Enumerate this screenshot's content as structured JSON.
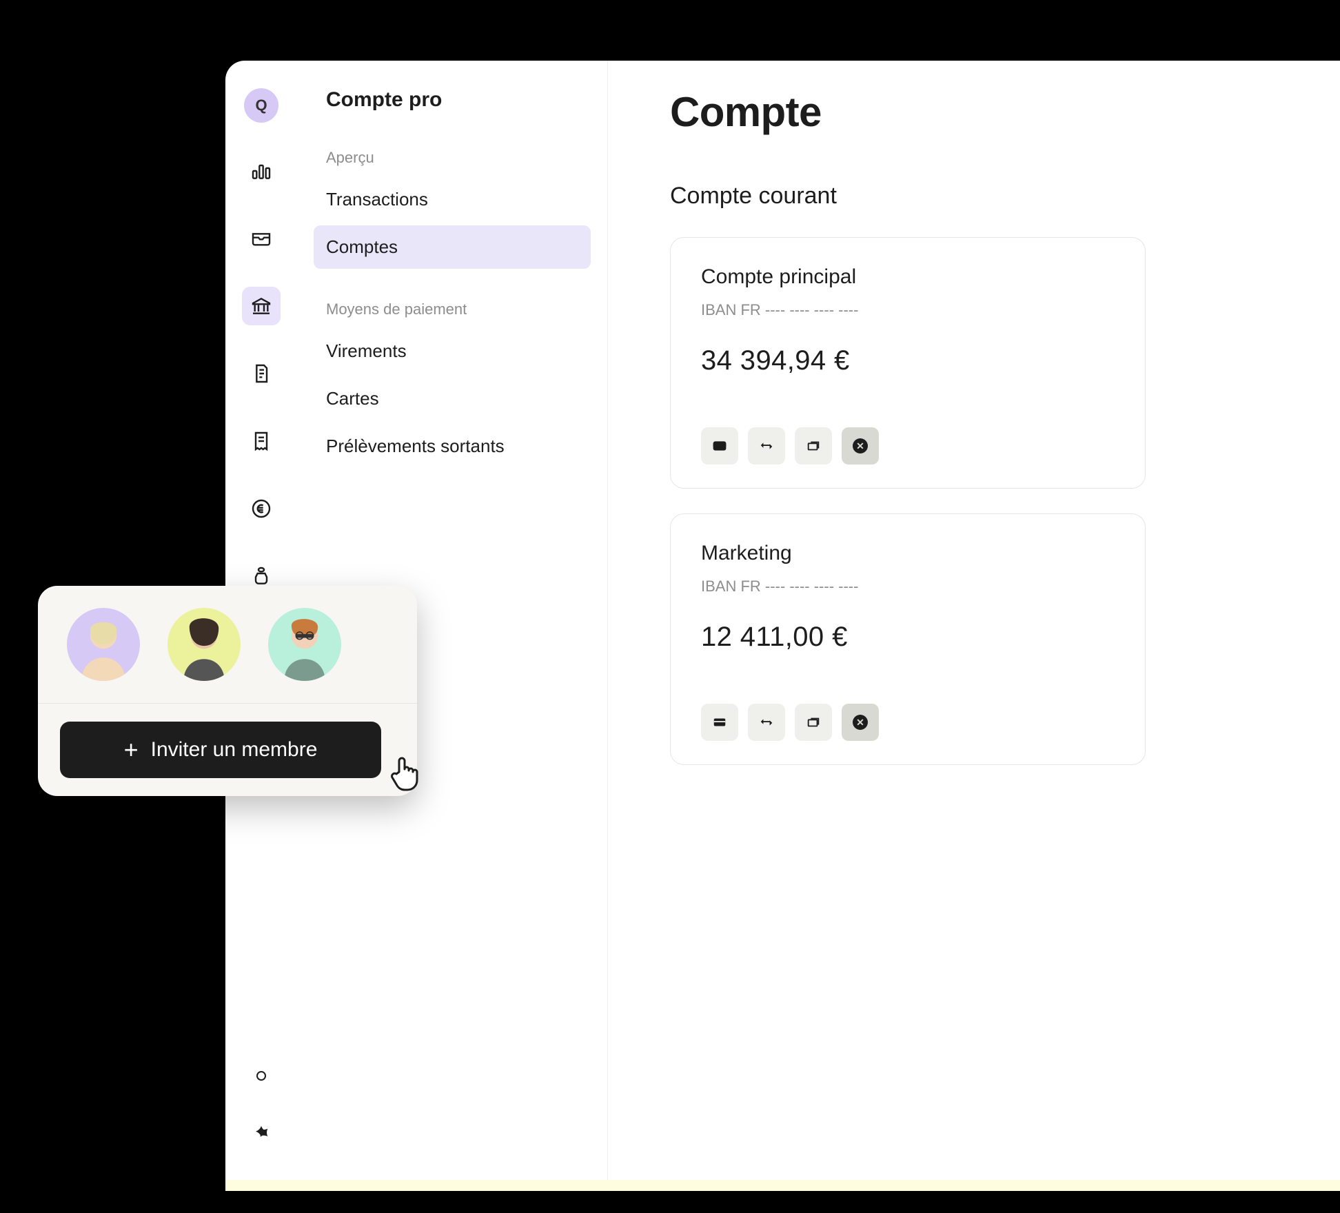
{
  "rail": {
    "logo_letter": "Q"
  },
  "sidebar": {
    "title": "Compte pro",
    "sections": [
      {
        "label": "Aperçu",
        "items": [
          "Transactions",
          "Comptes"
        ]
      },
      {
        "label": "Moyens de paiement",
        "items": [
          "Virements",
          "Cartes",
          "Prélèvements sortants"
        ]
      }
    ],
    "active_item": "Comptes"
  },
  "main": {
    "title": "Compte",
    "subtitle": "Compte courant",
    "accounts": [
      {
        "name": "Compte principal",
        "iban": "IBAN FR ---- ---- ---- ----",
        "balance": "34 394,94 €"
      },
      {
        "name": "Marketing",
        "iban": "IBAN FR ---- ---- ---- ----",
        "balance": "12 411,00 €"
      }
    ]
  },
  "invite": {
    "button_label": "Inviter un membre",
    "avatar_colors": [
      "#d6c9f5",
      "#ecf29c",
      "#b8f0dc"
    ]
  }
}
